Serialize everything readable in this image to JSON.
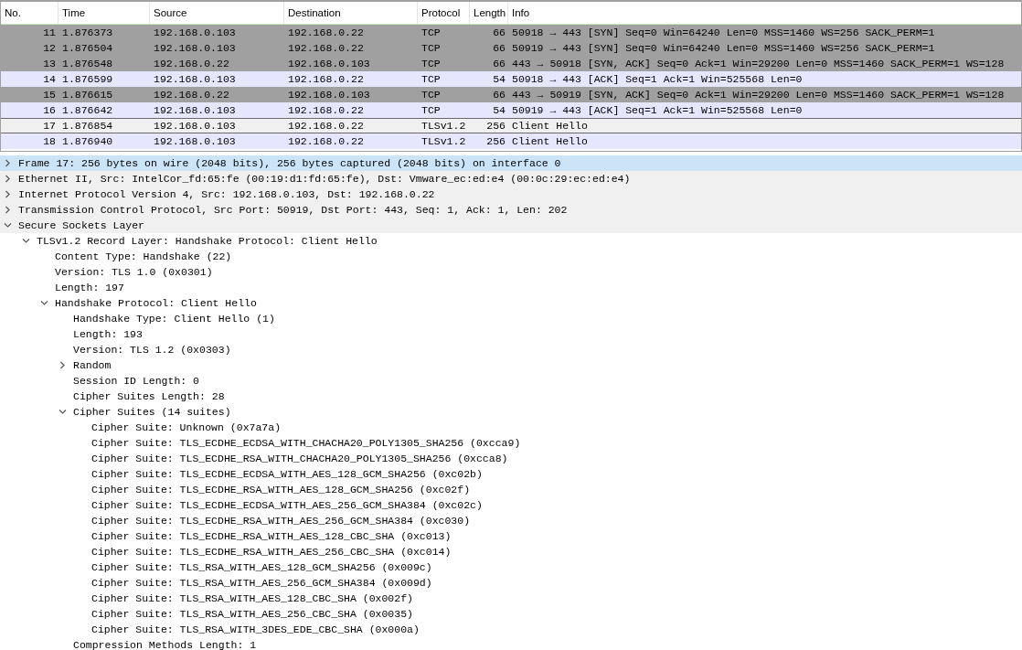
{
  "packet_list": {
    "columns": [
      "No.",
      "Time",
      "Source",
      "Destination",
      "Protocol",
      "Length",
      "Info"
    ],
    "rows": [
      {
        "no": "11",
        "time": "1.876373",
        "source": "192.168.0.103",
        "destination": "192.168.0.22",
        "protocol": "TCP",
        "length": "66",
        "info": "50918 → 443 [SYN] Seq=0 Win=64240 Len=0 MSS=1460 WS=256 SACK_PERM=1",
        "color": "#a0a0a0",
        "selected": false
      },
      {
        "no": "12",
        "time": "1.876504",
        "source": "192.168.0.103",
        "destination": "192.168.0.22",
        "protocol": "TCP",
        "length": "66",
        "info": "50919 → 443 [SYN] Seq=0 Win=64240 Len=0 MSS=1460 WS=256 SACK_PERM=1",
        "color": "#a0a0a0",
        "selected": false
      },
      {
        "no": "13",
        "time": "1.876548",
        "source": "192.168.0.22",
        "destination": "192.168.0.103",
        "protocol": "TCP",
        "length": "66",
        "info": "443 → 50918 [SYN, ACK] Seq=0 Ack=1 Win=29200 Len=0 MSS=1460 SACK_PERM=1 WS=128",
        "color": "#a0a0a0",
        "selected": false
      },
      {
        "no": "14",
        "time": "1.876599",
        "source": "192.168.0.103",
        "destination": "192.168.0.22",
        "protocol": "TCP",
        "length": "54",
        "info": "50918 → 443 [ACK] Seq=1 Ack=1 Win=525568 Len=0",
        "color": "#e7e6ff",
        "selected": false
      },
      {
        "no": "15",
        "time": "1.876615",
        "source": "192.168.0.22",
        "destination": "192.168.0.103",
        "protocol": "TCP",
        "length": "66",
        "info": "443 → 50919 [SYN, ACK] Seq=0 Ack=1 Win=29200 Len=0 MSS=1460 SACK_PERM=1 WS=128",
        "color": "#a0a0a0",
        "selected": false
      },
      {
        "no": "16",
        "time": "1.876642",
        "source": "192.168.0.103",
        "destination": "192.168.0.22",
        "protocol": "TCP",
        "length": "54",
        "info": "50919 → 443 [ACK] Seq=1 Ack=1 Win=525568 Len=0",
        "color": "#e7e6ff",
        "selected": false
      },
      {
        "no": "17",
        "time": "1.876854",
        "source": "192.168.0.103",
        "destination": "192.168.0.22",
        "protocol": "TLSv1.2",
        "length": "256",
        "info": "Client Hello",
        "color": "#f0f0f0",
        "selected": true
      },
      {
        "no": "18",
        "time": "1.876940",
        "source": "192.168.0.103",
        "destination": "192.168.0.22",
        "protocol": "TLSv1.2",
        "length": "256",
        "info": "Client Hello",
        "color": "#e7e6ff",
        "selected": false
      }
    ]
  },
  "details": [
    {
      "label": "Frame 17: 256 bytes on wire (2048 bits), 256 bytes captured (2048 bits) on interface 0",
      "expanded": false,
      "selected": true
    },
    {
      "label": "Ethernet II, Src: IntelCor_fd:65:fe (00:19:d1:fd:65:fe), Dst: Vmware_ec:ed:e4 (00:0c:29:ec:ed:e4)",
      "expanded": false,
      "selected": false
    },
    {
      "label": "Internet Protocol Version 4, Src: 192.168.0.103, Dst: 192.168.0.22",
      "expanded": false,
      "selected": false
    },
    {
      "label": "Transmission Control Protocol, Src Port: 50919, Dst Port: 443, Seq: 1, Ack: 1, Len: 202",
      "expanded": false,
      "selected": false
    },
    {
      "label": "Secure Sockets Layer",
      "expanded": true,
      "selected": false,
      "children": [
        {
          "label": "TLSv1.2 Record Layer: Handshake Protocol: Client Hello",
          "expanded": true,
          "selected": false,
          "children": [
            {
              "label": "Content Type: Handshake (22)",
              "selected": false
            },
            {
              "label": "Version: TLS 1.0 (0x0301)",
              "selected": false
            },
            {
              "label": "Length: 197",
              "selected": false
            },
            {
              "label": "Handshake Protocol: Client Hello",
              "expanded": true,
              "selected": false,
              "children": [
                {
                  "label": "Handshake Type: Client Hello (1)",
                  "selected": false
                },
                {
                  "label": "Length: 193",
                  "selected": false
                },
                {
                  "label": "Version: TLS 1.2 (0x0303)",
                  "selected": false
                },
                {
                  "label": "Random",
                  "expanded": false,
                  "selected": false
                },
                {
                  "label": "Session ID Length: 0",
                  "selected": false
                },
                {
                  "label": "Cipher Suites Length: 28",
                  "selected": false
                },
                {
                  "label": "Cipher Suites (14 suites)",
                  "expanded": true,
                  "selected": false,
                  "children": [
                    {
                      "label": "Cipher Suite: Unknown (0x7a7a)",
                      "selected": false
                    },
                    {
                      "label": "Cipher Suite: TLS_ECDHE_ECDSA_WITH_CHACHA20_POLY1305_SHA256 (0xcca9)",
                      "selected": false
                    },
                    {
                      "label": "Cipher Suite: TLS_ECDHE_RSA_WITH_CHACHA20_POLY1305_SHA256 (0xcca8)",
                      "selected": false
                    },
                    {
                      "label": "Cipher Suite: TLS_ECDHE_ECDSA_WITH_AES_128_GCM_SHA256 (0xc02b)",
                      "selected": false
                    },
                    {
                      "label": "Cipher Suite: TLS_ECDHE_RSA_WITH_AES_128_GCM_SHA256 (0xc02f)",
                      "selected": false
                    },
                    {
                      "label": "Cipher Suite: TLS_ECDHE_ECDSA_WITH_AES_256_GCM_SHA384 (0xc02c)",
                      "selected": false
                    },
                    {
                      "label": "Cipher Suite: TLS_ECDHE_RSA_WITH_AES_256_GCM_SHA384 (0xc030)",
                      "selected": false
                    },
                    {
                      "label": "Cipher Suite: TLS_ECDHE_RSA_WITH_AES_128_CBC_SHA (0xc013)",
                      "selected": false
                    },
                    {
                      "label": "Cipher Suite: TLS_ECDHE_RSA_WITH_AES_256_CBC_SHA (0xc014)",
                      "selected": false
                    },
                    {
                      "label": "Cipher Suite: TLS_RSA_WITH_AES_128_GCM_SHA256 (0x009c)",
                      "selected": false
                    },
                    {
                      "label": "Cipher Suite: TLS_RSA_WITH_AES_256_GCM_SHA384 (0x009d)",
                      "selected": false
                    },
                    {
                      "label": "Cipher Suite: TLS_RSA_WITH_AES_128_CBC_SHA (0x002f)",
                      "selected": false
                    },
                    {
                      "label": "Cipher Suite: TLS_RSA_WITH_AES_256_CBC_SHA (0x0035)",
                      "selected": false
                    },
                    {
                      "label": "Cipher Suite: TLS_RSA_WITH_3DES_EDE_CBC_SHA (0x000a)",
                      "selected": false
                    }
                  ]
                },
                {
                  "label": "Compression Methods Length: 1",
                  "selected": false
                }
              ]
            }
          ]
        }
      ]
    }
  ]
}
